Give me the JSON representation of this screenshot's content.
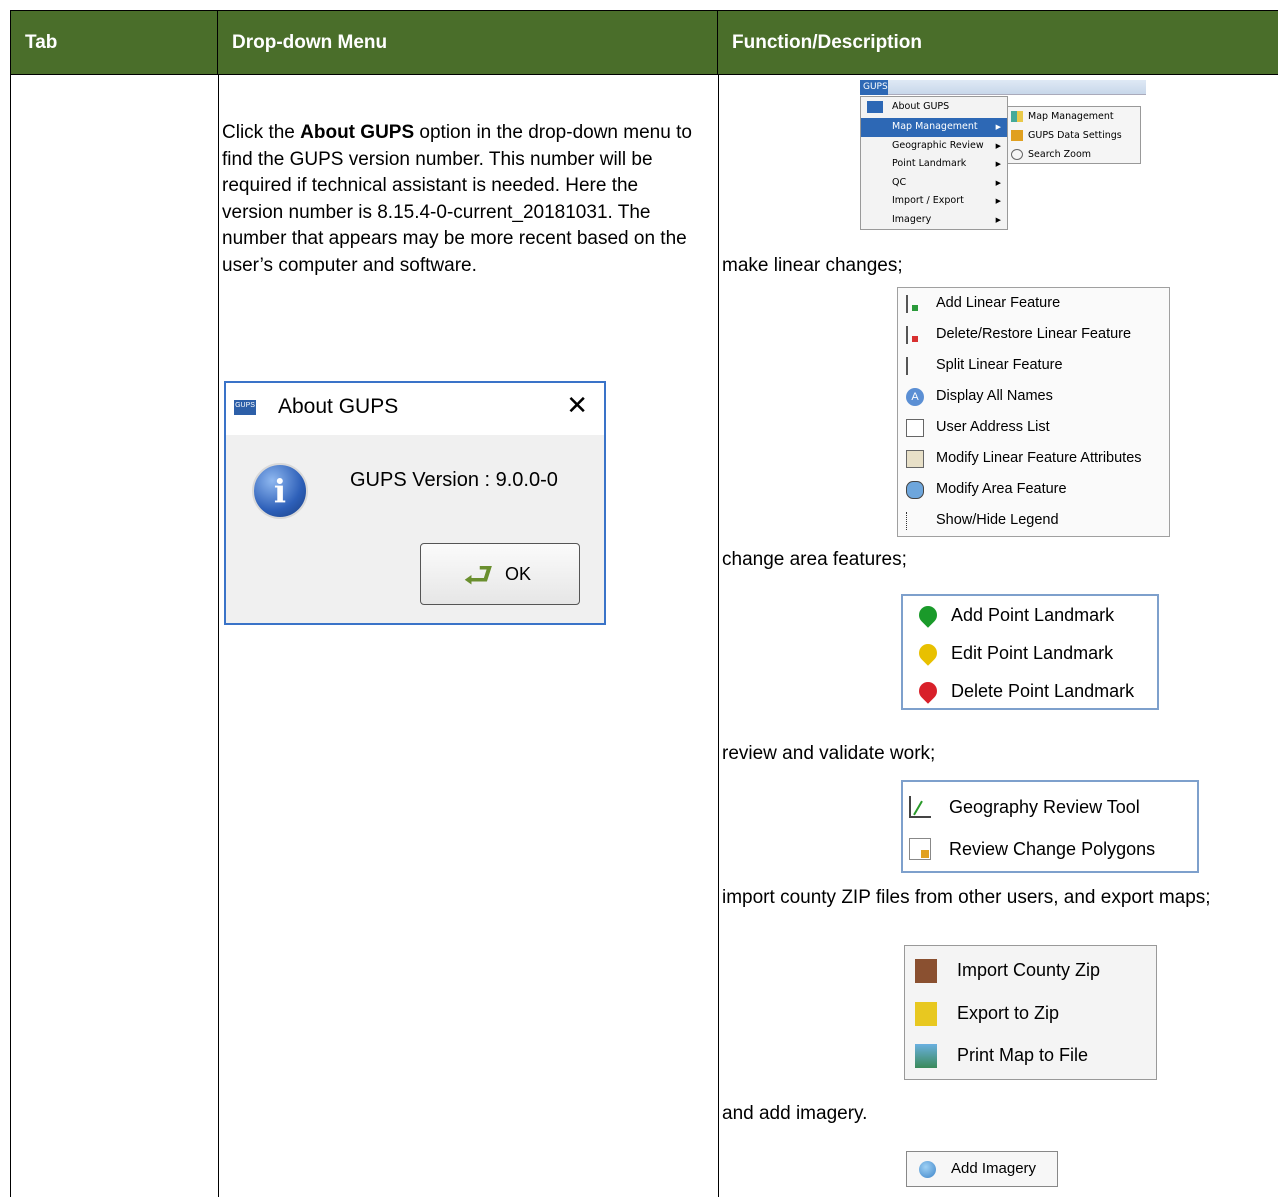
{
  "header": {
    "col_tab": "Tab",
    "col_menu": "Drop-down Menu",
    "col_desc": "Function/Description"
  },
  "body": {
    "text_prefix": "Click the ",
    "text_bold": "About GUPS",
    "text_suffix": " option in the drop-down menu to find the GUPS version number. This number will be required if technical assistant is needed. Here the version number is 8.15.4-0-current_20181031. The number that appears may be more recent based on the user’s computer and software."
  },
  "about_dialog": {
    "logo": "GUPS",
    "title": "About GUPS",
    "close": "✕",
    "version": "GUPS Version : 9.0.0-0",
    "ok": "OK"
  },
  "gups_menu": {
    "tab": "GUPS",
    "items": [
      "About GUPS",
      "Map Management",
      "Geographic Review",
      "Point Landmark",
      "QC",
      "Import / Export",
      "Imagery"
    ],
    "submenu": [
      "Map Management",
      "GUPS Data Settings",
      "Search Zoom"
    ]
  },
  "descriptions": {
    "linear": "make linear changes;",
    "area": "change area features;",
    "review": "review and validate work;",
    "import": "import county ZIP files from other users, and export maps;",
    "imagery": "and add imagery."
  },
  "linear_menu": [
    "Add Linear Feature",
    "Delete/Restore Linear Feature",
    "Split Linear Feature",
    "Display All Names",
    "User Address List",
    "Modify Linear Feature Attributes",
    "Modify Area Feature",
    "Show/Hide Legend"
  ],
  "point_menu": [
    "Add Point Landmark",
    "Edit Point Landmark",
    "Delete Point Landmark"
  ],
  "review_menu": [
    "Geography Review Tool",
    "Review Change Polygons"
  ],
  "import_menu": [
    "Import County Zip",
    "Export to Zip",
    "Print Map to File"
  ],
  "imagery_menu": [
    "Add Imagery"
  ],
  "colors": {
    "header_bg": "#4a6e2a",
    "menu_highlight": "#2d68b5",
    "add_point": "#1a9a2a",
    "edit_point": "#e8c000",
    "delete_point": "#d8202a"
  }
}
